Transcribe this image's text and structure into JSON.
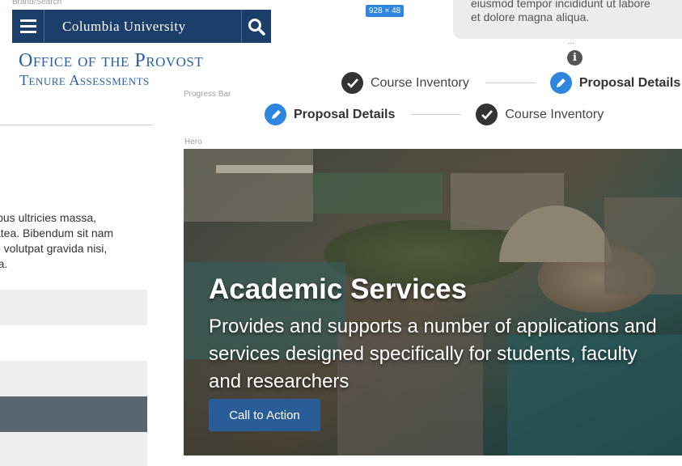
{
  "annotations": {
    "brand_search": "Brand/Search",
    "dimensions": "928 × 48",
    "progress_bar": "Progress Bar",
    "hero": "Hero"
  },
  "brand": {
    "university": "Columbia University",
    "office_title": "Office of the Provost",
    "office_subtitle": "Tenure Assessments"
  },
  "tooltip": {
    "lines": [
      "eiusmod tempor incididunt ut labore",
      "et dolore magna aliqua."
    ],
    "ellipsis": "..."
  },
  "progress_top": {
    "steps": [
      {
        "label": "Course Inventory",
        "state": "done"
      },
      {
        "label": "Proposal Details",
        "state": "active"
      }
    ]
  },
  "progress_main": {
    "steps": [
      {
        "label": "Proposal Details",
        "state": "active"
      },
      {
        "label": "Course Inventory",
        "state": "done"
      }
    ]
  },
  "left_panel": {
    "text_lines": [
      "ibus ultricies massa,",
      "atea. Bibendum sit nam",
      "e volutpat gravida nisi,",
      "ra."
    ]
  },
  "hero": {
    "title": "Academic Services",
    "description_lines": [
      "Provides and supports a number of applications and",
      "services designed specifically for students, faculty",
      "and researchers"
    ],
    "cta_label": "Call to Action"
  },
  "colors": {
    "brand_navy": "#1c3e6b",
    "brand_blue": "#2a5fa8",
    "active_step": "#2e86de",
    "cta": "#2a5d97"
  },
  "icons": [
    "menu-icon",
    "search-icon",
    "info-icon",
    "check-icon",
    "pencil-icon"
  ]
}
